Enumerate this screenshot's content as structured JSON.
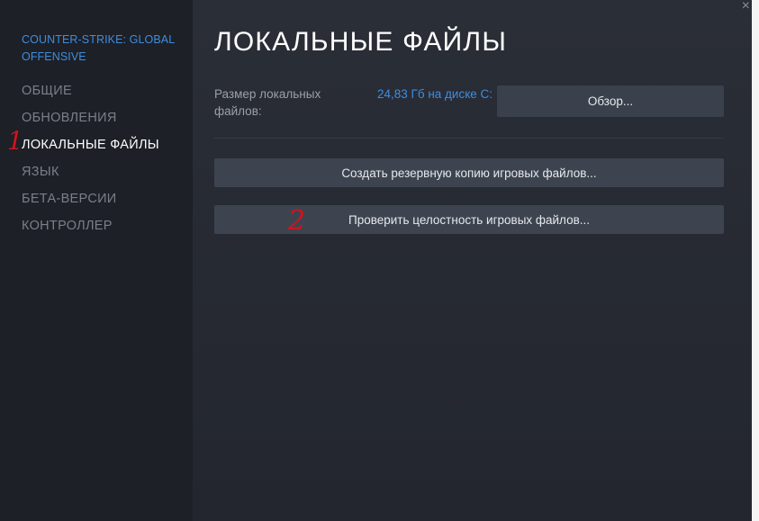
{
  "sidebar": {
    "game_title": "COUNTER-STRIKE: GLOBAL OFFENSIVE",
    "items": [
      {
        "label": "ОБЩИЕ"
      },
      {
        "label": "ОБНОВЛЕНИЯ"
      },
      {
        "label": "ЛОКАЛЬНЫЕ ФАЙЛЫ",
        "active": true
      },
      {
        "label": "ЯЗЫК"
      },
      {
        "label": "БЕТА-ВЕРСИИ"
      },
      {
        "label": "КОНТРОЛЛЕР"
      }
    ]
  },
  "main": {
    "title": "ЛОКАЛЬНЫЕ ФАЙЛЫ",
    "size_label": "Размер локальных файлов:",
    "size_value": "24,83 Гб на диске C:",
    "browse_label": "Обзор...",
    "backup_label": "Создать резервную копию игровых файлов...",
    "verify_label": "Проверить целостность игровых файлов..."
  },
  "window": {
    "close_glyph": "×"
  },
  "annotations": {
    "mark_1": "1",
    "mark_2": "2"
  },
  "colors": {
    "accent": "#3d8de0",
    "annotation": "#d0141b"
  },
  "icons": {
    "close": "close-icon"
  }
}
